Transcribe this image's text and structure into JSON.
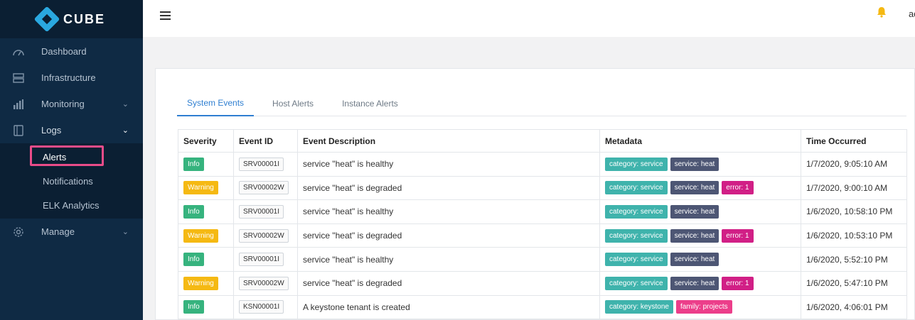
{
  "brand": {
    "name": "CUBE"
  },
  "sidebar": {
    "items": [
      {
        "label": "Dashboard",
        "icon": "speedometer-icon"
      },
      {
        "label": "Infrastructure",
        "icon": "server-icon"
      },
      {
        "label": "Monitoring",
        "icon": "bar-chart-icon"
      },
      {
        "label": "Logs",
        "icon": "log-icon"
      },
      {
        "label": "Manage",
        "icon": "gear-icon"
      }
    ],
    "logs_subitems": [
      {
        "label": "Alerts"
      },
      {
        "label": "Notifications"
      },
      {
        "label": "ELK Analytics"
      }
    ]
  },
  "topbar": {
    "user": "ad"
  },
  "tabs": [
    {
      "label": "System Events"
    },
    {
      "label": "Host Alerts"
    },
    {
      "label": "Instance Alerts"
    }
  ],
  "table": {
    "headers": [
      "Severity",
      "Event ID",
      "Event Description",
      "Metadata",
      "Time Occurred"
    ],
    "rows": [
      {
        "severity": "Info",
        "event_id": "SRV00001I",
        "description": "service \"heat\" is healthy",
        "tags": [
          "category: service",
          "service: heat"
        ],
        "time": "1/7/2020, 9:05:10 AM"
      },
      {
        "severity": "Warning",
        "event_id": "SRV00002W",
        "description": "service \"heat\" is degraded",
        "tags": [
          "category: service",
          "service: heat",
          "error: 1"
        ],
        "time": "1/7/2020, 9:00:10 AM"
      },
      {
        "severity": "Info",
        "event_id": "SRV00001I",
        "description": "service \"heat\" is healthy",
        "tags": [
          "category: service",
          "service: heat"
        ],
        "time": "1/6/2020, 10:58:10 PM"
      },
      {
        "severity": "Warning",
        "event_id": "SRV00002W",
        "description": "service \"heat\" is degraded",
        "tags": [
          "category: service",
          "service: heat",
          "error: 1"
        ],
        "time": "1/6/2020, 10:53:10 PM"
      },
      {
        "severity": "Info",
        "event_id": "SRV00001I",
        "description": "service \"heat\" is healthy",
        "tags": [
          "category: service",
          "service: heat"
        ],
        "time": "1/6/2020, 5:52:10 PM"
      },
      {
        "severity": "Warning",
        "event_id": "SRV00002W",
        "description": "service \"heat\" is degraded",
        "tags": [
          "category: service",
          "service: heat",
          "error: 1"
        ],
        "time": "1/6/2020, 5:47:10 PM"
      },
      {
        "severity": "Info",
        "event_id": "KSN00001I",
        "description": "A keystone tenant is created",
        "tags": [
          "category: keystone",
          "family: projects"
        ],
        "time": "1/6/2020, 4:06:01 PM"
      }
    ]
  },
  "colors": {
    "sidebar_bg": "#0f2a44",
    "accent": "#2f7fd1",
    "info": "#36b37e",
    "warning": "#f5b913",
    "highlight": "#ea4c89"
  }
}
